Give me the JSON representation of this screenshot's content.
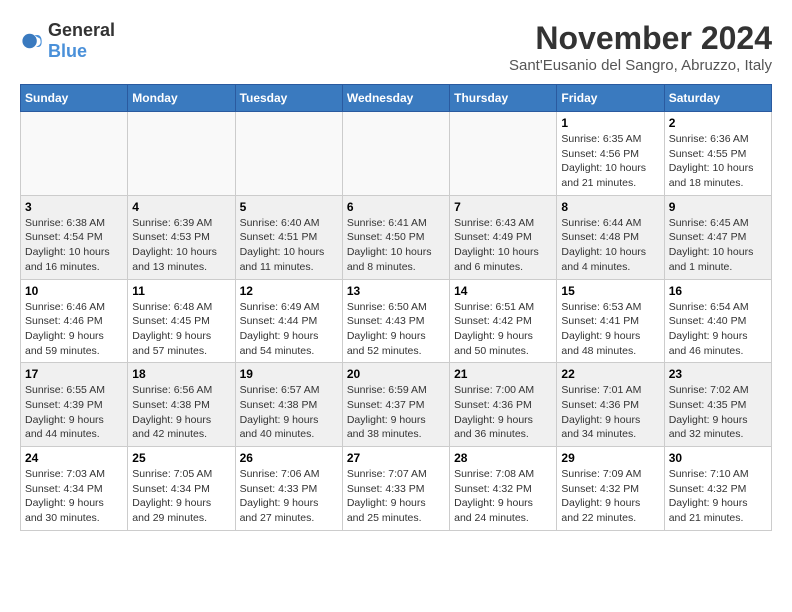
{
  "logo": {
    "text_general": "General",
    "text_blue": "Blue"
  },
  "title": "November 2024",
  "location": "Sant'Eusanio del Sangro, Abruzzo, Italy",
  "days_of_week": [
    "Sunday",
    "Monday",
    "Tuesday",
    "Wednesday",
    "Thursday",
    "Friday",
    "Saturday"
  ],
  "weeks": [
    [
      {
        "day": "",
        "info": ""
      },
      {
        "day": "",
        "info": ""
      },
      {
        "day": "",
        "info": ""
      },
      {
        "day": "",
        "info": ""
      },
      {
        "day": "",
        "info": ""
      },
      {
        "day": "1",
        "info": "Sunrise: 6:35 AM\nSunset: 4:56 PM\nDaylight: 10 hours and 21 minutes."
      },
      {
        "day": "2",
        "info": "Sunrise: 6:36 AM\nSunset: 4:55 PM\nDaylight: 10 hours and 18 minutes."
      }
    ],
    [
      {
        "day": "3",
        "info": "Sunrise: 6:38 AM\nSunset: 4:54 PM\nDaylight: 10 hours and 16 minutes."
      },
      {
        "day": "4",
        "info": "Sunrise: 6:39 AM\nSunset: 4:53 PM\nDaylight: 10 hours and 13 minutes."
      },
      {
        "day": "5",
        "info": "Sunrise: 6:40 AM\nSunset: 4:51 PM\nDaylight: 10 hours and 11 minutes."
      },
      {
        "day": "6",
        "info": "Sunrise: 6:41 AM\nSunset: 4:50 PM\nDaylight: 10 hours and 8 minutes."
      },
      {
        "day": "7",
        "info": "Sunrise: 6:43 AM\nSunset: 4:49 PM\nDaylight: 10 hours and 6 minutes."
      },
      {
        "day": "8",
        "info": "Sunrise: 6:44 AM\nSunset: 4:48 PM\nDaylight: 10 hours and 4 minutes."
      },
      {
        "day": "9",
        "info": "Sunrise: 6:45 AM\nSunset: 4:47 PM\nDaylight: 10 hours and 1 minute."
      }
    ],
    [
      {
        "day": "10",
        "info": "Sunrise: 6:46 AM\nSunset: 4:46 PM\nDaylight: 9 hours and 59 minutes."
      },
      {
        "day": "11",
        "info": "Sunrise: 6:48 AM\nSunset: 4:45 PM\nDaylight: 9 hours and 57 minutes."
      },
      {
        "day": "12",
        "info": "Sunrise: 6:49 AM\nSunset: 4:44 PM\nDaylight: 9 hours and 54 minutes."
      },
      {
        "day": "13",
        "info": "Sunrise: 6:50 AM\nSunset: 4:43 PM\nDaylight: 9 hours and 52 minutes."
      },
      {
        "day": "14",
        "info": "Sunrise: 6:51 AM\nSunset: 4:42 PM\nDaylight: 9 hours and 50 minutes."
      },
      {
        "day": "15",
        "info": "Sunrise: 6:53 AM\nSunset: 4:41 PM\nDaylight: 9 hours and 48 minutes."
      },
      {
        "day": "16",
        "info": "Sunrise: 6:54 AM\nSunset: 4:40 PM\nDaylight: 9 hours and 46 minutes."
      }
    ],
    [
      {
        "day": "17",
        "info": "Sunrise: 6:55 AM\nSunset: 4:39 PM\nDaylight: 9 hours and 44 minutes."
      },
      {
        "day": "18",
        "info": "Sunrise: 6:56 AM\nSunset: 4:38 PM\nDaylight: 9 hours and 42 minutes."
      },
      {
        "day": "19",
        "info": "Sunrise: 6:57 AM\nSunset: 4:38 PM\nDaylight: 9 hours and 40 minutes."
      },
      {
        "day": "20",
        "info": "Sunrise: 6:59 AM\nSunset: 4:37 PM\nDaylight: 9 hours and 38 minutes."
      },
      {
        "day": "21",
        "info": "Sunrise: 7:00 AM\nSunset: 4:36 PM\nDaylight: 9 hours and 36 minutes."
      },
      {
        "day": "22",
        "info": "Sunrise: 7:01 AM\nSunset: 4:36 PM\nDaylight: 9 hours and 34 minutes."
      },
      {
        "day": "23",
        "info": "Sunrise: 7:02 AM\nSunset: 4:35 PM\nDaylight: 9 hours and 32 minutes."
      }
    ],
    [
      {
        "day": "24",
        "info": "Sunrise: 7:03 AM\nSunset: 4:34 PM\nDaylight: 9 hours and 30 minutes."
      },
      {
        "day": "25",
        "info": "Sunrise: 7:05 AM\nSunset: 4:34 PM\nDaylight: 9 hours and 29 minutes."
      },
      {
        "day": "26",
        "info": "Sunrise: 7:06 AM\nSunset: 4:33 PM\nDaylight: 9 hours and 27 minutes."
      },
      {
        "day": "27",
        "info": "Sunrise: 7:07 AM\nSunset: 4:33 PM\nDaylight: 9 hours and 25 minutes."
      },
      {
        "day": "28",
        "info": "Sunrise: 7:08 AM\nSunset: 4:32 PM\nDaylight: 9 hours and 24 minutes."
      },
      {
        "day": "29",
        "info": "Sunrise: 7:09 AM\nSunset: 4:32 PM\nDaylight: 9 hours and 22 minutes."
      },
      {
        "day": "30",
        "info": "Sunrise: 7:10 AM\nSunset: 4:32 PM\nDaylight: 9 hours and 21 minutes."
      }
    ]
  ]
}
